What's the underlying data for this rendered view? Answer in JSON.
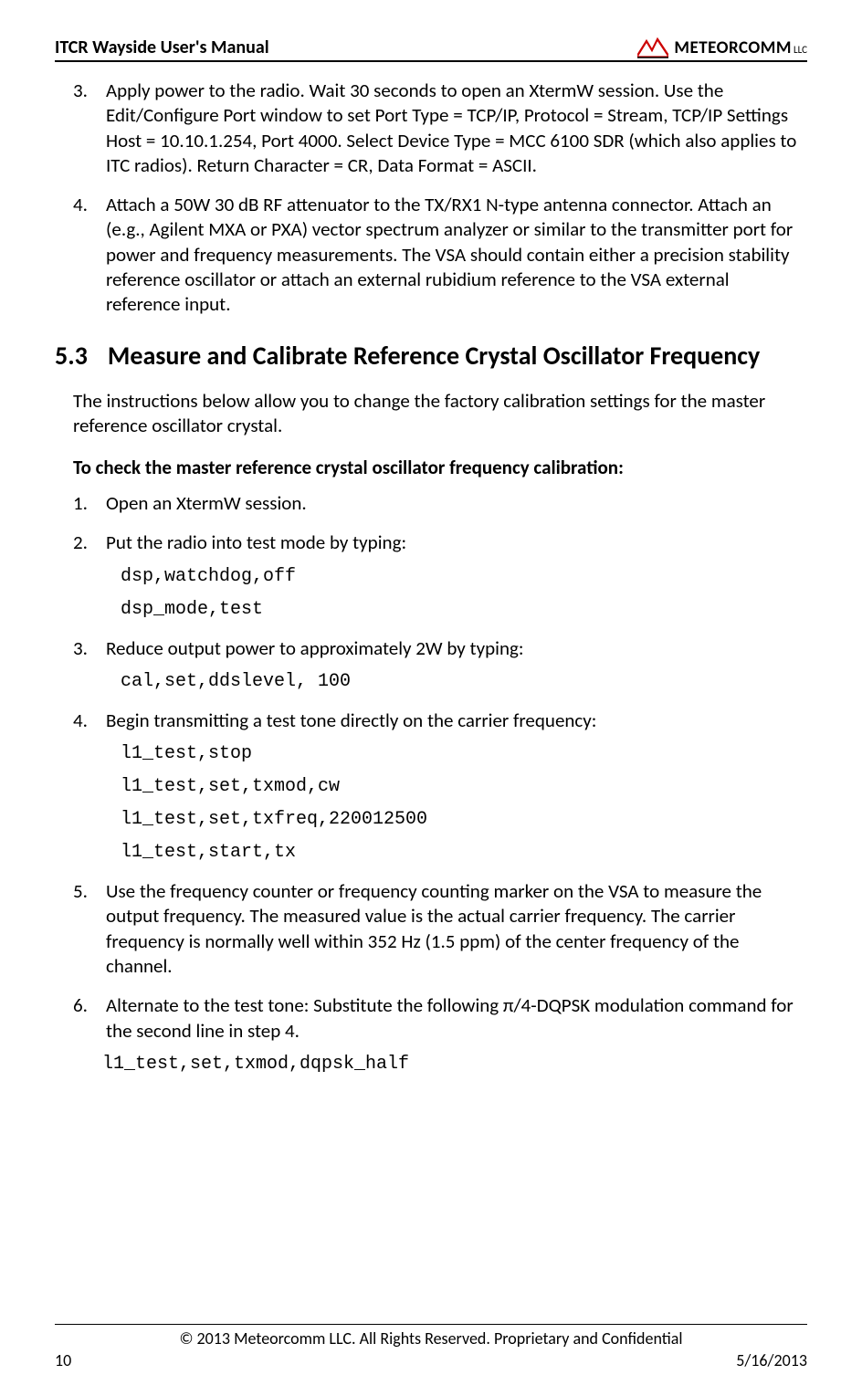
{
  "header": {
    "title": "ITCR Wayside User's Manual",
    "logo_text": "METEORCOMM",
    "logo_suffix": "LLC"
  },
  "items_top": [
    {
      "num": "3.",
      "text": "Apply power to the radio. Wait 30 seconds to open an XtermW session. Use the Edit/Configure Port window to set Port Type = TCP/IP, Protocol = Stream, TCP/IP Settings Host = 10.10.1.254, Port 4000. Select Device Type = MCC 6100 SDR (which also applies to ITC radios). Return Character = CR, Data Format = ASCII."
    },
    {
      "num": "4.",
      "text": "Attach a 50W 30 dB RF attenuator to the TX/RX1 N-type antenna connector. Attach an (e.g., Agilent MXA or PXA) vector spectrum analyzer or similar to the transmitter port for power and frequency measurements. The VSA should contain either a precision stability reference oscillator or attach an external rubidium reference to the VSA external reference input."
    }
  ],
  "section": {
    "num": "5.3",
    "title": "Measure and Calibrate Reference Crystal Oscillator Frequency"
  },
  "intro_para": "The instructions below allow you to change the factory calibration settings for the master reference oscillator crystal.",
  "bold_para": "To check the master reference crystal oscillator frequency calibration:",
  "steps": [
    {
      "num": "1.",
      "text": "Open an XtermW session.",
      "code": []
    },
    {
      "num": "2.",
      "text": "Put the radio into test mode by typing:",
      "code": [
        "dsp,watchdog,off",
        "dsp_mode,test"
      ]
    },
    {
      "num": "3.",
      "text": "Reduce output power to approximately 2W by typing:",
      "code": [
        "cal,set,ddslevel, 100"
      ]
    },
    {
      "num": "4.",
      "text": "Begin transmitting a test tone directly on the carrier frequency:",
      "code": [
        "l1_test,stop",
        "l1_test,set,txmod,cw",
        "l1_test,set,txfreq,220012500",
        "l1_test,start,tx"
      ]
    },
    {
      "num": "5.",
      "text": "Use the frequency counter or frequency counting marker on the VSA to measure the output frequency. The measured value is the actual carrier frequency. The carrier frequency is normally well within 352 Hz (1.5 ppm) of the center frequency of the channel.",
      "code": []
    },
    {
      "num": "6.",
      "text": "Alternate to the test tone: Substitute the following π/4-DQPSK modulation command for the second line in step 4.",
      "code": [
        "l1_test,set,txmod,dqpsk_half"
      ],
      "code_outdent": true
    }
  ],
  "footer": {
    "copyright": "© 2013 Meteorcomm LLC. All Rights Reserved. Proprietary and Confidential",
    "page": "10",
    "date": "5/16/2013"
  }
}
